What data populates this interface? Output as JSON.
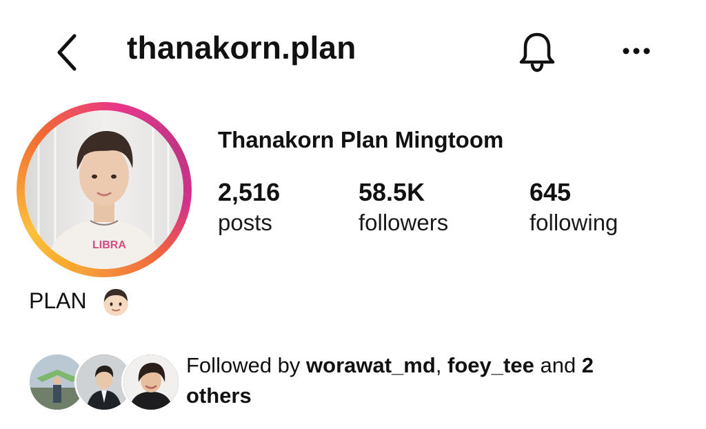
{
  "header": {
    "username": "thanakorn.plan",
    "back_icon": "chevron-left-icon",
    "notifications_icon": "bell-icon",
    "more_icon": "more-horizontal-icon"
  },
  "profile": {
    "full_name": "Thanakorn Plan Mingtoom",
    "avatar_shirt_text": "LIBRA",
    "stats": {
      "posts": {
        "value": "2,516",
        "label": "posts"
      },
      "followers": {
        "value": "58.5K",
        "label": "followers"
      },
      "following": {
        "value": "645",
        "label": "following"
      }
    },
    "bio": {
      "name": "PLAN",
      "emoji": "boy-face-emoji"
    }
  },
  "followed_by": {
    "prefix": "Followed by ",
    "user1": "worawat_md",
    "sep": ", ",
    "user2": "foey_tee",
    "middle": " and ",
    "count": "2",
    "suffix": "others"
  },
  "colors": {
    "story_ring": [
      "#f8a32b",
      "#f26b33",
      "#e8368a",
      "#c13584"
    ],
    "text": "#111111"
  }
}
